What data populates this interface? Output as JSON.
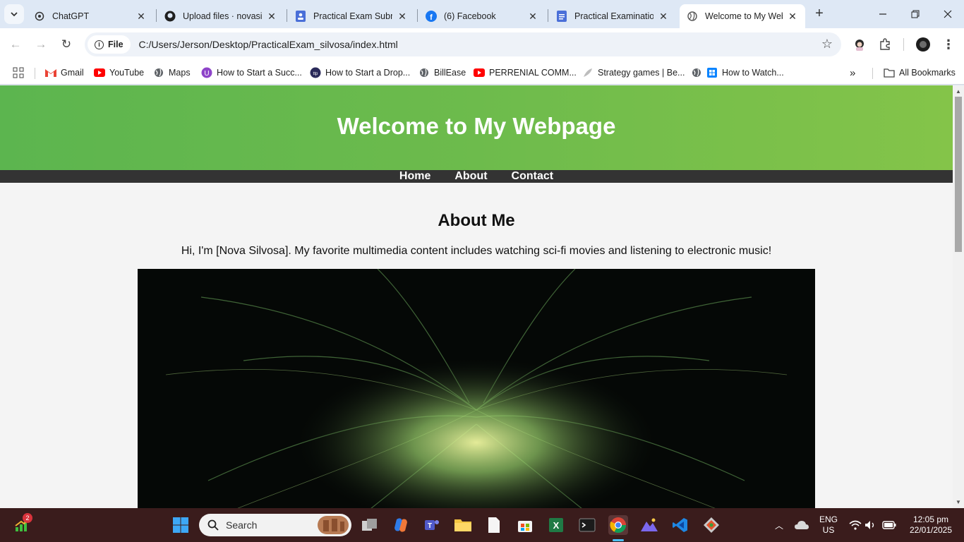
{
  "browser": {
    "tabs": [
      {
        "title": "ChatGPT",
        "icon": "chatgpt-icon"
      },
      {
        "title": "Upload files · novasilv",
        "icon": "github-icon"
      },
      {
        "title": "Practical Exam Submi",
        "icon": "google-forms-icon"
      },
      {
        "title": "(6) Facebook",
        "icon": "facebook-icon"
      },
      {
        "title": "Practical Examination",
        "icon": "google-docs-icon"
      },
      {
        "title": "Welcome to My Web",
        "icon": "globe-icon",
        "active": true
      }
    ],
    "address": {
      "chip_label": "File",
      "url": "C:/Users/Jerson/Desktop/PracticalExam_silvosa/index.html"
    },
    "bookmarks": [
      {
        "label": "Gmail",
        "icon": "gmail-icon"
      },
      {
        "label": "YouTube",
        "icon": "youtube-icon"
      },
      {
        "label": "Maps",
        "icon": "globe-icon"
      },
      {
        "label": "How to Start a Succ...",
        "icon": "purple-u-icon"
      },
      {
        "label": "How to Start a Drop...",
        "icon": "dtp-icon"
      },
      {
        "label": "BillEase",
        "icon": "globe-icon"
      },
      {
        "label": "PERRENIAL COMM...",
        "icon": "youtube-icon"
      },
      {
        "label": "Strategy games | Be...",
        "icon": "feather-icon"
      },
      {
        "label": "How to Watch...",
        "icon": "windows-icon"
      }
    ],
    "all_bookmarks_label": "All Bookmarks"
  },
  "page": {
    "header_title": "Welcome to My Webpage",
    "nav": [
      "Home",
      "About",
      "Contact"
    ],
    "section_title": "About Me",
    "section_text": "Hi, I'm [Nova Silvosa]. My favorite multimedia content includes watching sci-fi movies and listening to electronic music!"
  },
  "taskbar": {
    "search_placeholder": "Search",
    "notification_count": "2",
    "language": "ENG",
    "region": "US",
    "time": "12:05 pm",
    "date": "22/01/2025"
  },
  "colors": {
    "header_green": "#6dbb4c",
    "nav_bar": "#333333",
    "page_bg": "#f4f4f4"
  }
}
